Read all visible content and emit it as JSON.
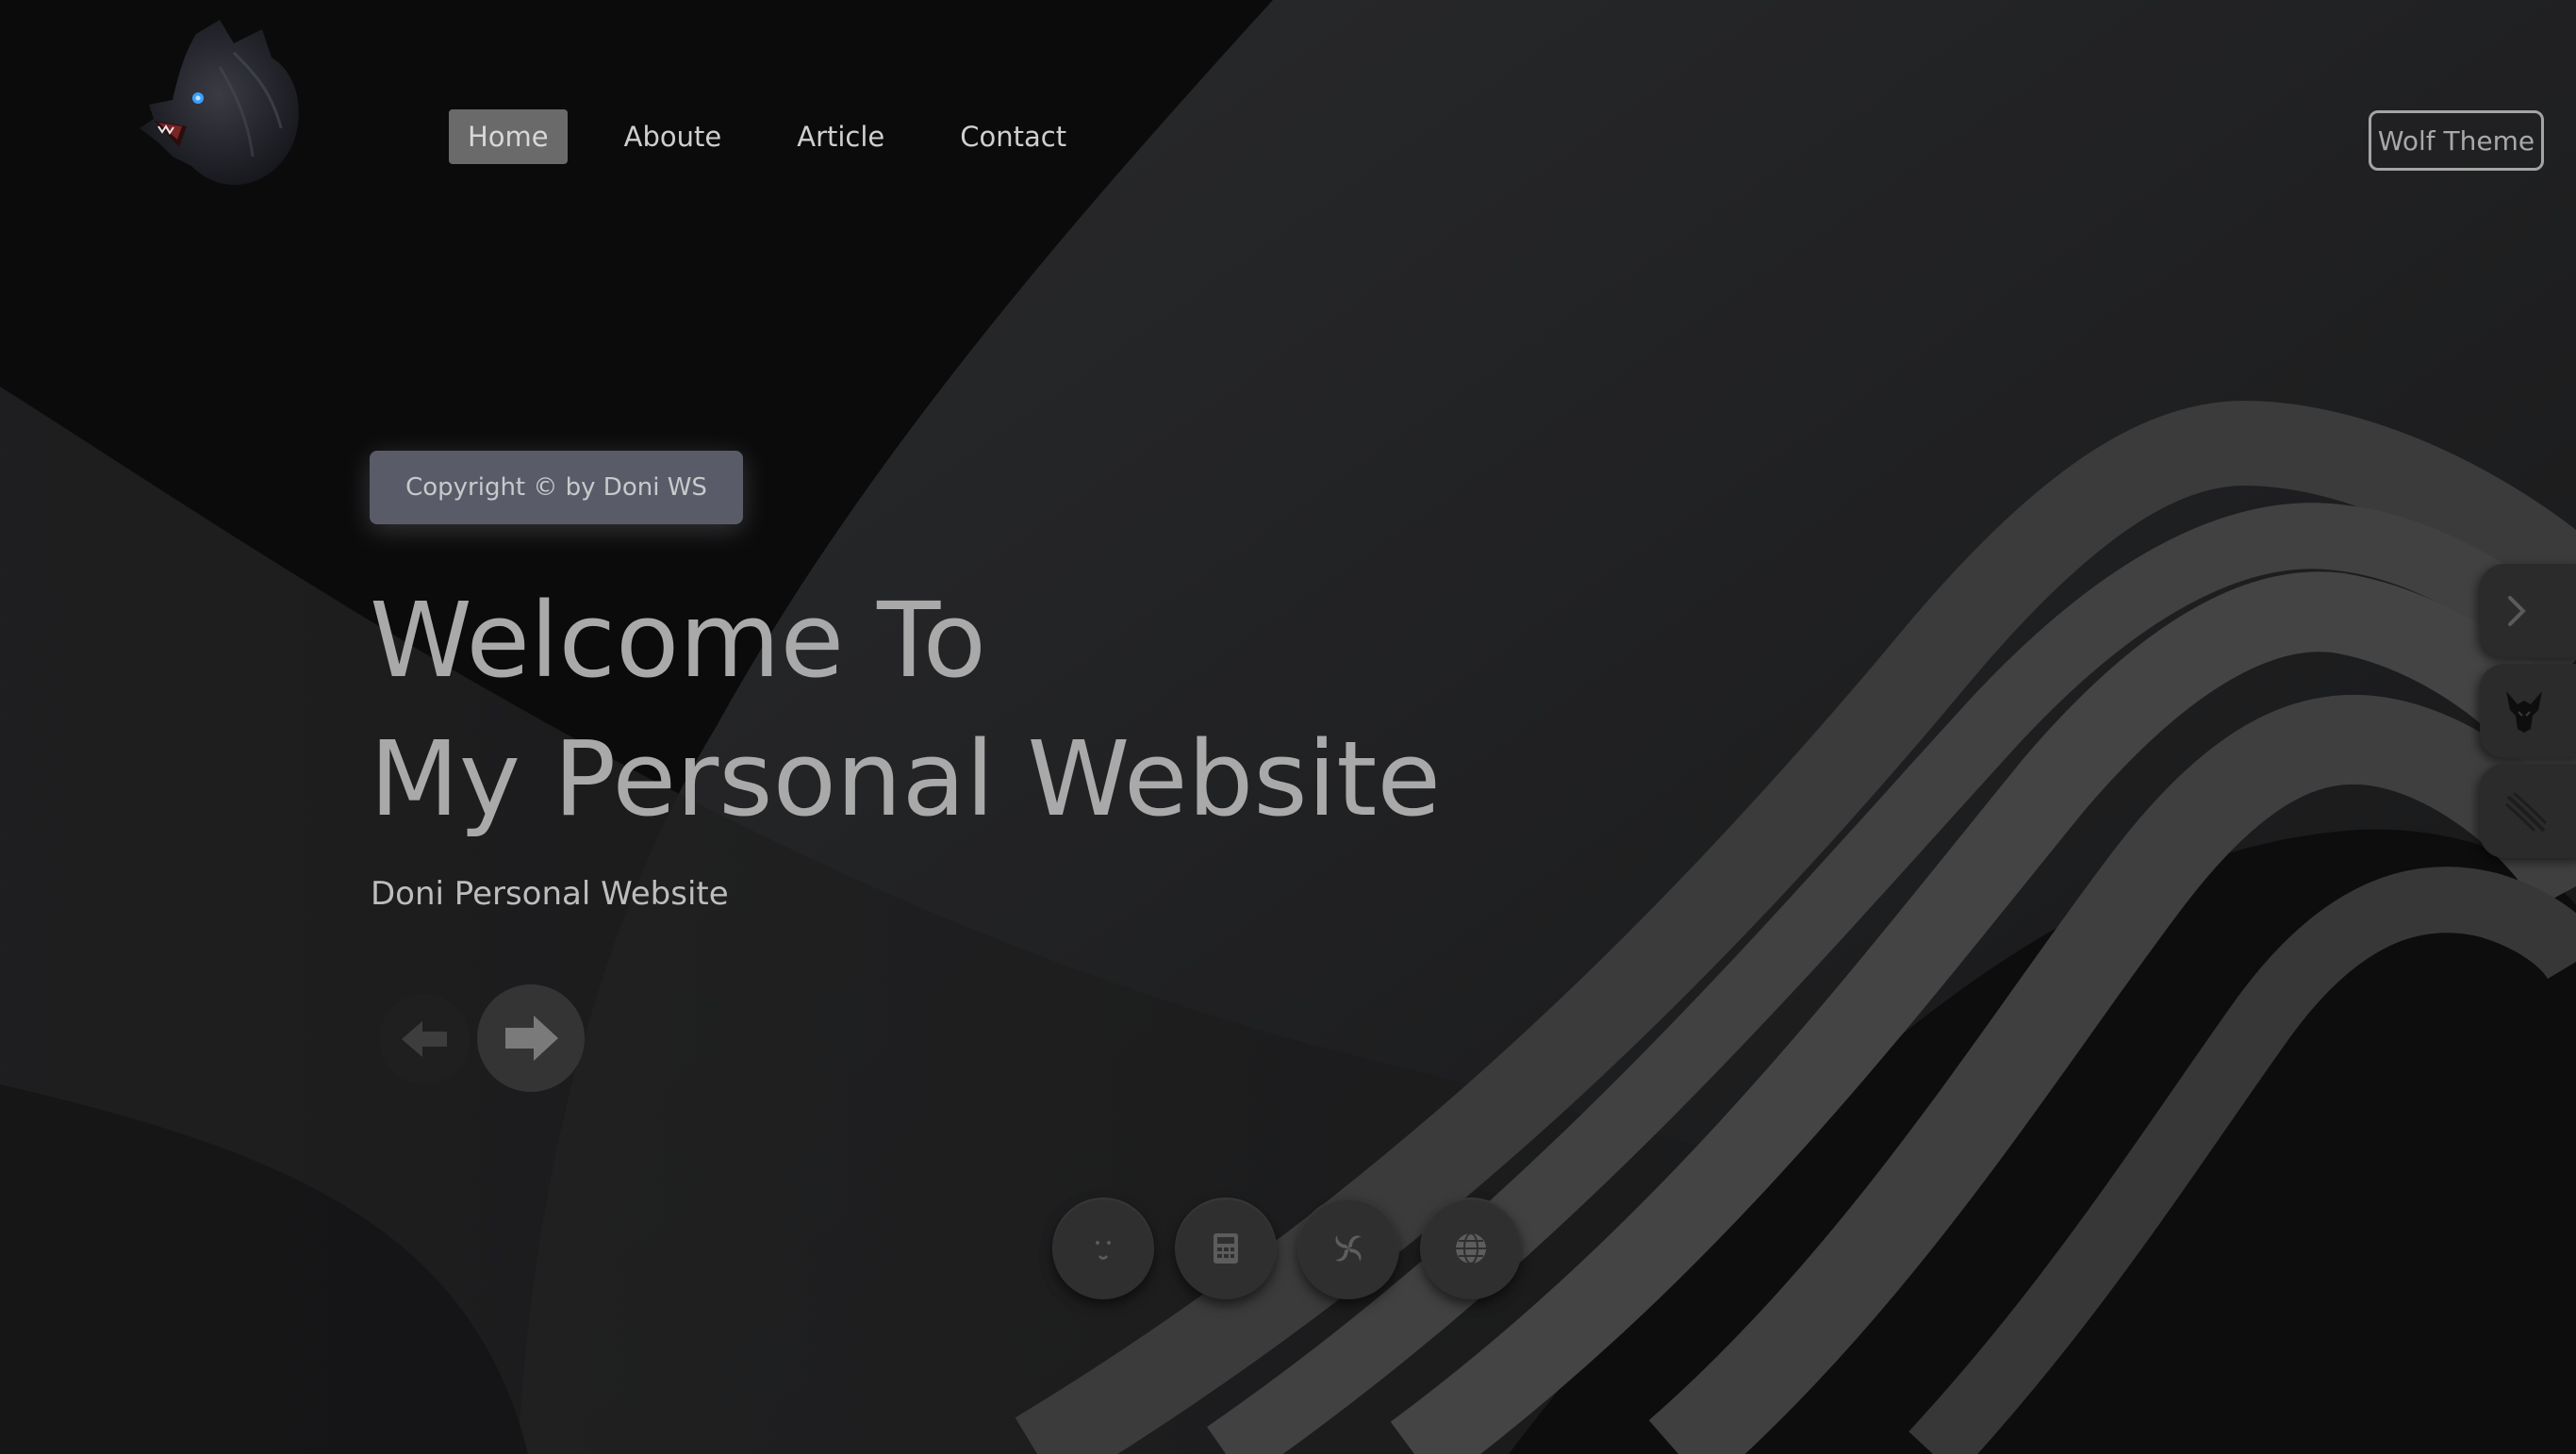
{
  "nav": {
    "items": [
      {
        "label": "Home",
        "active": true
      },
      {
        "label": "Aboute",
        "active": false
      },
      {
        "label": "Article",
        "active": false
      },
      {
        "label": "Contact",
        "active": false
      }
    ]
  },
  "theme_button": {
    "label": "Wolf Theme"
  },
  "hero": {
    "badge": "Copyright © by Doni WS",
    "title_line1": "Welcome To",
    "title_line2": "My Personal Website",
    "subtitle": "Doni Personal Website"
  },
  "controls": {
    "prev_icon": "arrow-left-icon",
    "next_icon": "arrow-right-icon"
  },
  "social_icons": [
    "face-icon",
    "calculator-icon",
    "swirl-icon",
    "globe-icon"
  ],
  "side_buttons": [
    "chevron-right-icon",
    "wolf-icon",
    "claw-icon"
  ],
  "colors": {
    "background": "#0b0b0c",
    "nav_active_bg": "#6a6a6a",
    "badge_bg": "#595c68",
    "headline": "#a9a9a9"
  }
}
